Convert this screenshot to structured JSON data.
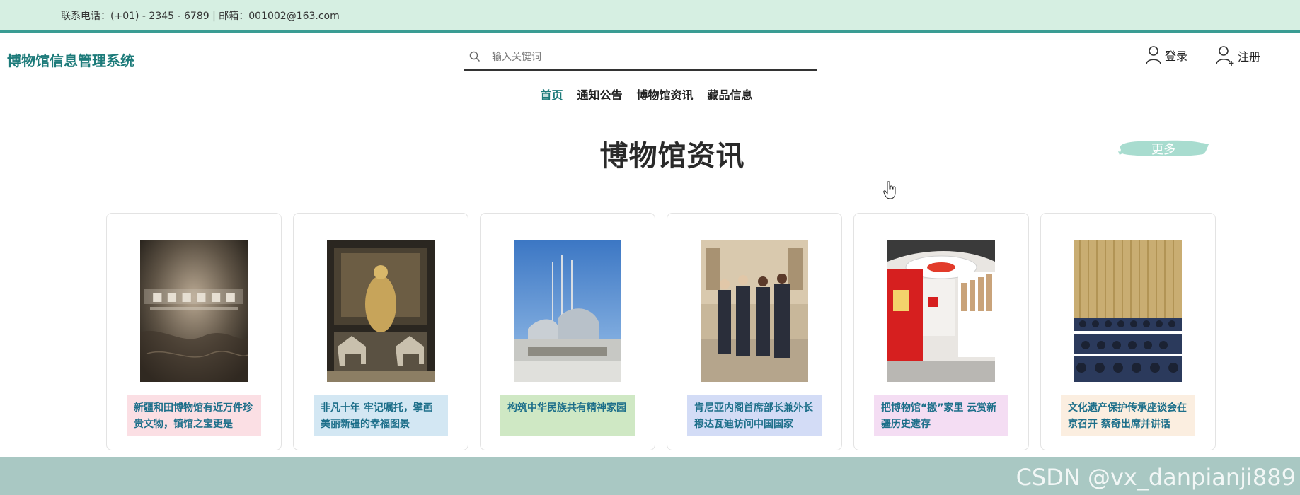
{
  "topbar": {
    "contact": "联系电话：(+01) - 2345 - 6789 | 邮箱：001002@163.com"
  },
  "header": {
    "site_title": "博物馆信息管理系统",
    "search": {
      "placeholder": "输入关键词",
      "value": ""
    },
    "login_label": "登录",
    "register_label": "注册"
  },
  "nav": {
    "items": [
      {
        "label": "首页",
        "active": true
      },
      {
        "label": "通知公告",
        "active": false
      },
      {
        "label": "博物馆资讯",
        "active": false
      },
      {
        "label": "藏品信息",
        "active": false
      }
    ]
  },
  "section": {
    "title": "博物馆资讯",
    "more_label": "更多"
  },
  "cards": [
    {
      "caption": "新疆和田博物馆有近万件珍贵文物，镇馆之宝更是",
      "caption_bg": "#fbdfe4",
      "image": "exhibition-hall-sign"
    },
    {
      "caption": "非凡十年 牢记嘱托，擘画美丽新疆的幸福图景",
      "caption_bg": "#d3e7f3",
      "image": "museum-horse-statues"
    },
    {
      "caption": "构筑中华民族共有精神家园",
      "caption_bg": "#cfe8c4",
      "image": "museum-building-exterior"
    },
    {
      "caption": "肯尼亚内阁首席部长兼外长穆达瓦迪访问中国国家",
      "caption_bg": "#d3dcf6",
      "image": "delegation-visit"
    },
    {
      "caption": "把博物馆“搬”家里 云赏新疆历史遗存",
      "caption_bg": "#f4ddf3",
      "image": "red-exhibition-hall"
    },
    {
      "caption": "文化遗产保护传承座谈会在京召开 蔡奇出席并讲话",
      "caption_bg": "#fbeee0",
      "image": "conference-meeting"
    }
  ],
  "footer": {
    "watermark": "CSDN @vx_danpianji889"
  },
  "colors": {
    "accent": "#1d7b7a",
    "topbar_bg": "#d6efe2",
    "topbar_border": "#3a9c93",
    "footer_bg": "#a9c8c3",
    "more_brush": "#a8dccf"
  }
}
